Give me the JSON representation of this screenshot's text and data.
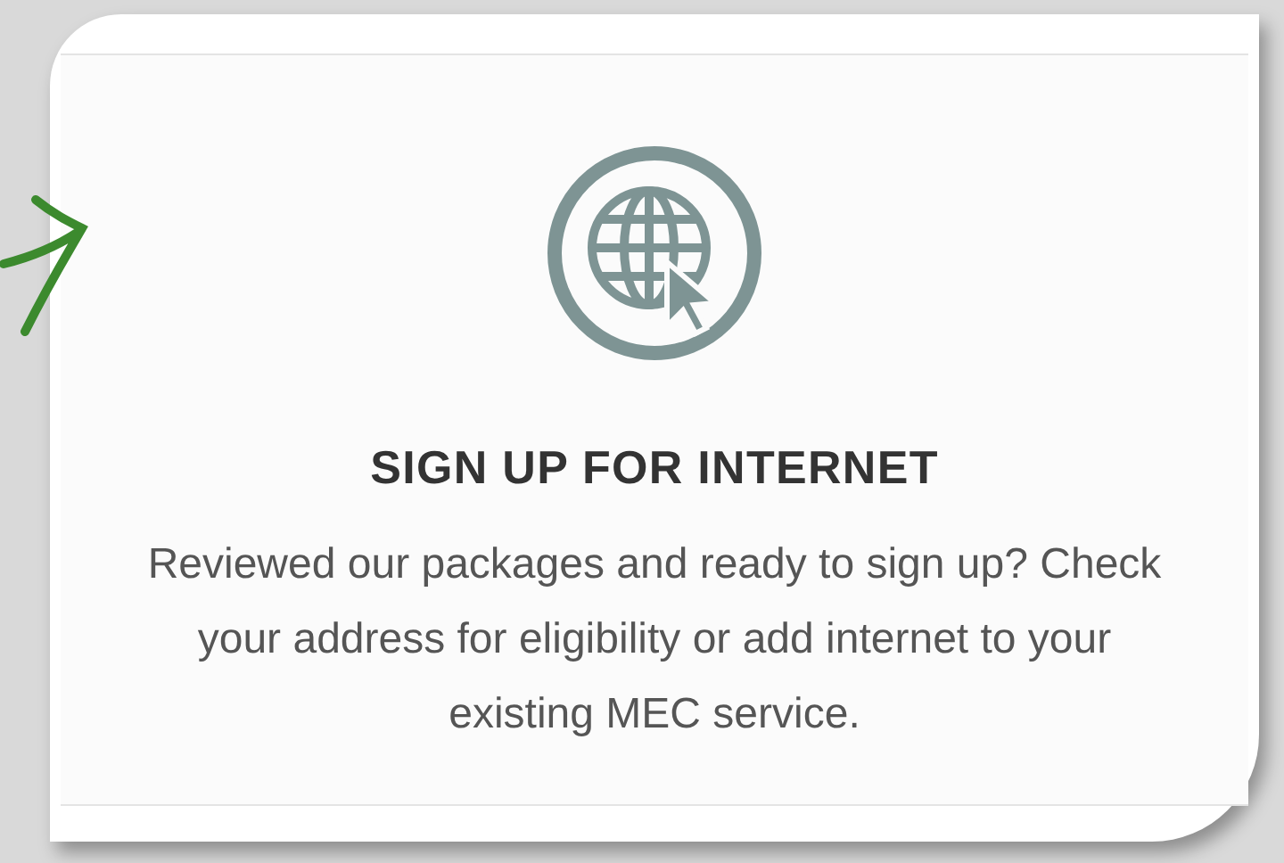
{
  "card": {
    "title": "SIGN UP FOR INTERNET",
    "description": "Reviewed our packages and ready to sign up? Check your address for eligibility or add internet to your existing MEC service."
  }
}
